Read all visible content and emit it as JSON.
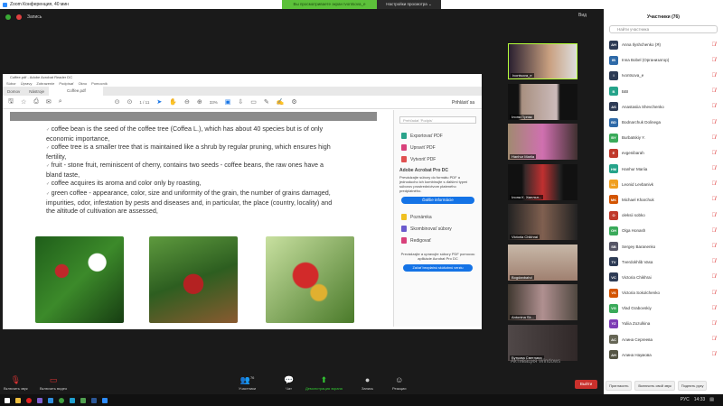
{
  "titlebar": {
    "title": "Zoom Конференция, 40 мин",
    "banner": "Вы просматриваете экран Ivontsova_e",
    "view_options": "Настройки просмотра ⌄"
  },
  "zoom_top": {
    "record": "Запись",
    "view": "Вид"
  },
  "acrobat": {
    "title": "Coffee.pdf - Adobe Acrobat Reader DC",
    "menu": [
      "Súbor",
      "Úpravy",
      "Zobrazenie",
      "Podpísať",
      "Okno",
      "Pomocník"
    ],
    "tabs": [
      "Domov",
      "Nástroje",
      "Coffee.pdf"
    ],
    "page": "1 / 11",
    "zoom": "33%",
    "signin": "Prihlásiť sa",
    "bullets": [
      "coffee bean is the seed of the coffee tree (Coffea L.), which has about 40 species but is of only economic importance,",
      "coffee tree is a smaller tree that is maintained like a shrub by regular pruning, which ensures high fertility,",
      "fruit - stone fruit, reminiscent of cherry, contains two seeds - coffee beans, the raw ones have a bland taste,",
      "coffee acquires its aroma and color only by roasting,",
      "green coffee - appearance, color, size and uniformity of the grain, the number of grains damaged, impurities, odor, infestation by pests and diseases and, in particular, the place (country, locality) and the altitude of cultivation are assessed,"
    ],
    "pane": {
      "search": "Prehľadať 'Podpis'",
      "items": [
        "Exportovať PDF",
        "Upraviť PDF",
        "Vytvoriť PDF"
      ],
      "promo_title": "Adobe Acrobat Pro DC",
      "promo_text": "Prevádzajte súbory do formátu PDF a jednoducho ich kombinujte s ďalšími typmi súborov prostredníctvom plateného predplatného.",
      "promo_btn": "Ďalšie informácie",
      "tools": [
        "Poznámka",
        "Skombinovať súbory",
        "Redigovať"
      ],
      "footer": "Prevádzajte a upravujte súbory PDF pomocou aplikácie Acrobat Pro DC",
      "trial": "Začať bezplatnú skúšobnú verziu"
    }
  },
  "videos": [
    "Ivontsova_e",
    "Ілона Гірняк",
    "Hanhur Mariia",
    "Ілона К. Хмельн...",
    "Victoria Chikhrai",
    "Bogdanbahd",
    "Antonina Sk...",
    "Буткова Светлана"
  ],
  "activation": "Активация Windows",
  "toolbar": {
    "mute": "Включить звук",
    "video": "Включить видео",
    "participants": "Участники",
    "participants_count": "76",
    "chat": "Чат",
    "share": "Демонстрация экрана",
    "record": "Запись",
    "reactions": "Реакции",
    "leave": "Выйти"
  },
  "panel": {
    "title": "Участники (76)",
    "search": "Найти участника",
    "people": [
      {
        "i": "AH",
        "n": "Anna Ilyshchenko (Я)",
        "c": "#2d3b55"
      },
      {
        "i": "IB",
        "n": "Inna Bobel (Организатор)",
        "c": "#2e6aa8"
      },
      {
        "i": "I",
        "n": "Ivontsova_e",
        "c": "#2d3b55"
      },
      {
        "i": "B",
        "n": "БВІ",
        "c": "#25a38a"
      },
      {
        "i": "AS",
        "n": "Anastasiia Shevchenko",
        "c": "#2d3b55"
      },
      {
        "i": "BD",
        "n": "Bodnarchuk Dolinega",
        "c": "#2e6aa8"
      },
      {
        "i": "BY",
        "n": "Burbatskiy Y.",
        "c": "#3aaa5a"
      },
      {
        "i": "E",
        "n": "evgenibarah",
        "c": "#c0392b"
      },
      {
        "i": "HM",
        "n": "Hanhur Mariia",
        "c": "#25a38a"
      },
      {
        "i": "LL",
        "n": "Leonid Levbanivk",
        "c": "#f0a020"
      },
      {
        "i": "MK",
        "n": "Michael Kharchuk",
        "c": "#d35400"
      },
      {
        "i": "O",
        "n": "oleksii sobko",
        "c": "#c0392b"
      },
      {
        "i": "OH",
        "n": "Olga Honash",
        "c": "#3aaa5a"
      },
      {
        "i": "SB",
        "n": "Sergey Baranenko",
        "c": "#556"
      },
      {
        "i": "TV",
        "n": "Tverdokhlib Vasa",
        "c": "#2d3b55"
      },
      {
        "i": "VC",
        "n": "Victoria Chikhrai",
        "c": "#2d3b55"
      },
      {
        "i": "VS",
        "n": "Victoria Sokolchenko",
        "c": "#d35400"
      },
      {
        "i": "VG",
        "n": "Vlad Grabovskiy",
        "c": "#3aaa5a"
      },
      {
        "i": "YZ",
        "n": "Yuliia Zozulkina",
        "c": "#7d3cb5"
      },
      {
        "i": "АС",
        "n": "Алина Сергеева",
        "c": "#665"
      },
      {
        "i": "АН",
        "n": "Алина Наумова",
        "c": "#554"
      }
    ],
    "footer": [
      "Пригласить",
      "Включить свой звук",
      "Поднять руку"
    ]
  },
  "tray": {
    "lang": "РУС",
    "time": "14:33"
  }
}
